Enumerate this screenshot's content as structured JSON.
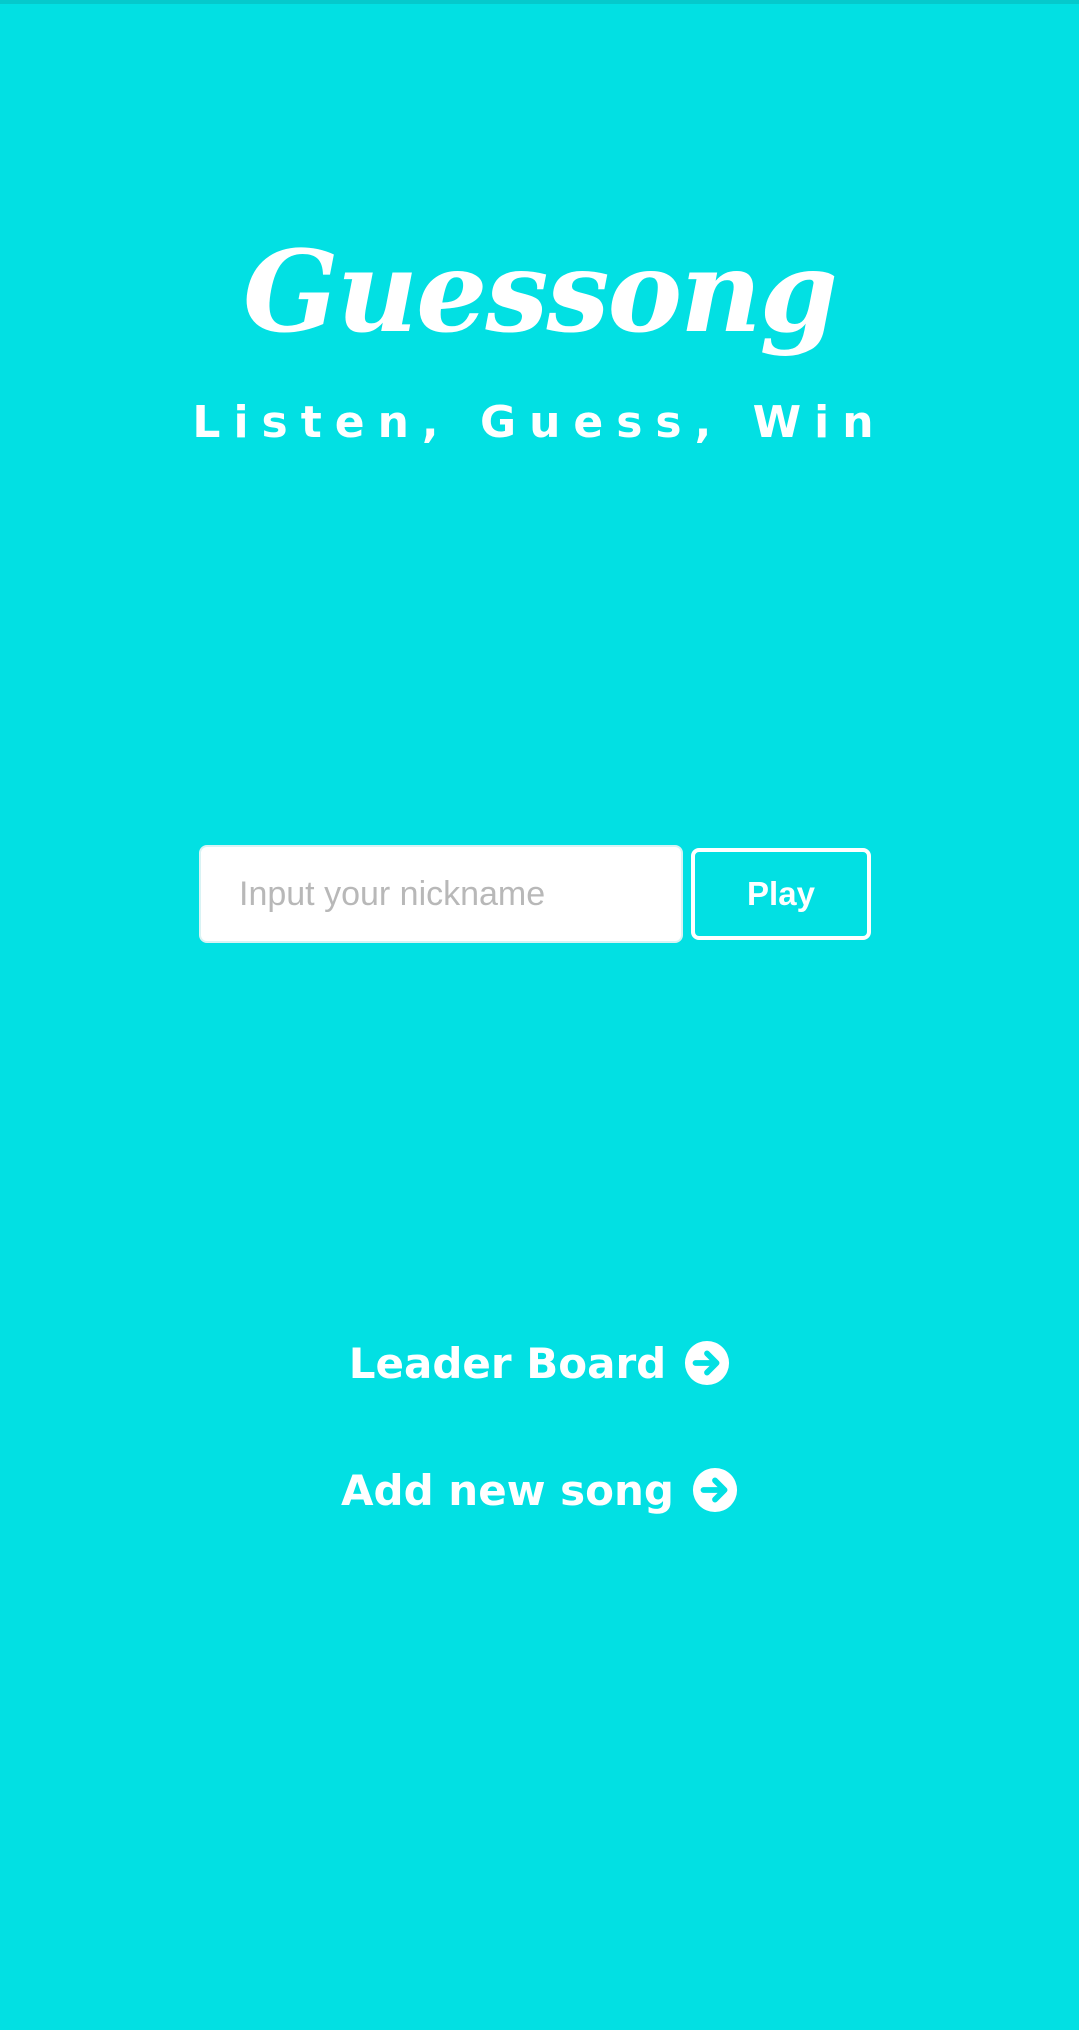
{
  "app": {
    "title": "Guessong",
    "tagline": "Listen, Guess, Win"
  },
  "form": {
    "nickname_placeholder": "Input your nickname",
    "nickname_value": "",
    "play_label": "Play"
  },
  "links": {
    "leaderboard_label": "Leader Board",
    "add_song_label": "Add new song"
  },
  "icons": {
    "link_icon": "arrow-right-circle-icon"
  },
  "colors": {
    "background": "#02e0e3",
    "foreground": "#ffffff",
    "input_background": "#ffffff",
    "placeholder": "#b8b8b8"
  }
}
